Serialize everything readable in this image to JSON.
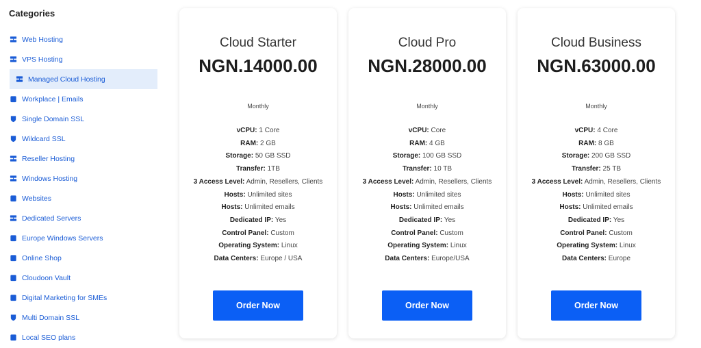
{
  "sidebar": {
    "title": "Categories",
    "items": [
      {
        "label": "Web Hosting",
        "icon": "server-icon",
        "active": false
      },
      {
        "label": "VPS Hosting",
        "icon": "server-icon",
        "active": false
      },
      {
        "label": "Managed Cloud Hosting",
        "icon": "server-icon",
        "active": true
      },
      {
        "label": "Workplace | Emails",
        "icon": "box-icon",
        "active": false
      },
      {
        "label": "Single Domain SSL",
        "icon": "shield-icon",
        "active": false
      },
      {
        "label": "Wildcard SSL",
        "icon": "shield-icon",
        "active": false
      },
      {
        "label": "Reseller Hosting",
        "icon": "server-icon",
        "active": false
      },
      {
        "label": "Windows Hosting",
        "icon": "server-icon",
        "active": false
      },
      {
        "label": "Websites",
        "icon": "box-icon",
        "active": false
      },
      {
        "label": "Dedicated Servers",
        "icon": "server-icon",
        "active": false
      },
      {
        "label": "Europe Windows Servers",
        "icon": "box-icon",
        "active": false
      },
      {
        "label": "Online Shop",
        "icon": "box-icon",
        "active": false
      },
      {
        "label": "Cloudoon Vault",
        "icon": "box-icon",
        "active": false
      },
      {
        "label": "Digital Marketing for SMEs",
        "icon": "box-icon",
        "active": false
      },
      {
        "label": "Multi Domain SSL",
        "icon": "shield-icon",
        "active": false
      },
      {
        "label": "Local SEO plans",
        "icon": "box-icon",
        "active": false
      }
    ]
  },
  "plans": [
    {
      "name": "Cloud Starter",
      "price": "NGN.14000.00",
      "period": "Monthly",
      "features": [
        {
          "k": "vCPU:",
          "v": "1 Core"
        },
        {
          "k": "RAM:",
          "v": "2 GB"
        },
        {
          "k": "Storage:",
          "v": "50 GB SSD"
        },
        {
          "k": "Transfer:",
          "v": "1TB"
        },
        {
          "k": "3 Access Level:",
          "v": "Admin, Resellers, Clients"
        },
        {
          "k": "Hosts:",
          "v": "Unlimited sites"
        },
        {
          "k": "Hosts:",
          "v": "Unlimited emails"
        },
        {
          "k": "Dedicated IP:",
          "v": "Yes"
        },
        {
          "k": "Control Panel:",
          "v": "Custom"
        },
        {
          "k": "Operating System:",
          "v": "Linux"
        },
        {
          "k": "Data Centers:",
          "v": "Europe / USA"
        }
      ],
      "button": "Order Now"
    },
    {
      "name": "Cloud Pro",
      "price": "NGN.28000.00",
      "period": "Monthly",
      "features": [
        {
          "k": "vCPU:",
          "v": "Core"
        },
        {
          "k": "RAM:",
          "v": "4 GB"
        },
        {
          "k": "Storage:",
          "v": "100 GB SSD"
        },
        {
          "k": "Transfer:",
          "v": "10 TB"
        },
        {
          "k": "3 Access Level:",
          "v": "Admin, Resellers, Clients"
        },
        {
          "k": "Hosts:",
          "v": "Unlimited sites"
        },
        {
          "k": "Hosts:",
          "v": "Unlimited emails"
        },
        {
          "k": "Dedicated IP:",
          "v": "Yes"
        },
        {
          "k": "Control Panel:",
          "v": "Custom"
        },
        {
          "k": "Operating System:",
          "v": "Linux"
        },
        {
          "k": "Data Centers:",
          "v": "Europe/USA"
        }
      ],
      "button": "Order Now"
    },
    {
      "name": "Cloud Business",
      "price": "NGN.63000.00",
      "period": "Monthly",
      "features": [
        {
          "k": "vCPU:",
          "v": "4 Core"
        },
        {
          "k": "RAM:",
          "v": "8 GB"
        },
        {
          "k": "Storage:",
          "v": "200 GB SSD"
        },
        {
          "k": "Transfer:",
          "v": "25 TB"
        },
        {
          "k": "3 Access Level:",
          "v": "Admin, Resellers, Clients"
        },
        {
          "k": "Hosts:",
          "v": "Unlimited sites"
        },
        {
          "k": "Hosts:",
          "v": "Unlimited emails"
        },
        {
          "k": "Dedicated IP:",
          "v": "Yes"
        },
        {
          "k": "Control Panel:",
          "v": "Custom"
        },
        {
          "k": "Operating System:",
          "v": "Linux"
        },
        {
          "k": "Data Centers:",
          "v": "Europe"
        }
      ],
      "button": "Order Now"
    }
  ],
  "colors": {
    "accent": "#0b5ff5",
    "link": "#1a5cd6",
    "active_bg": "#e3edfb"
  }
}
